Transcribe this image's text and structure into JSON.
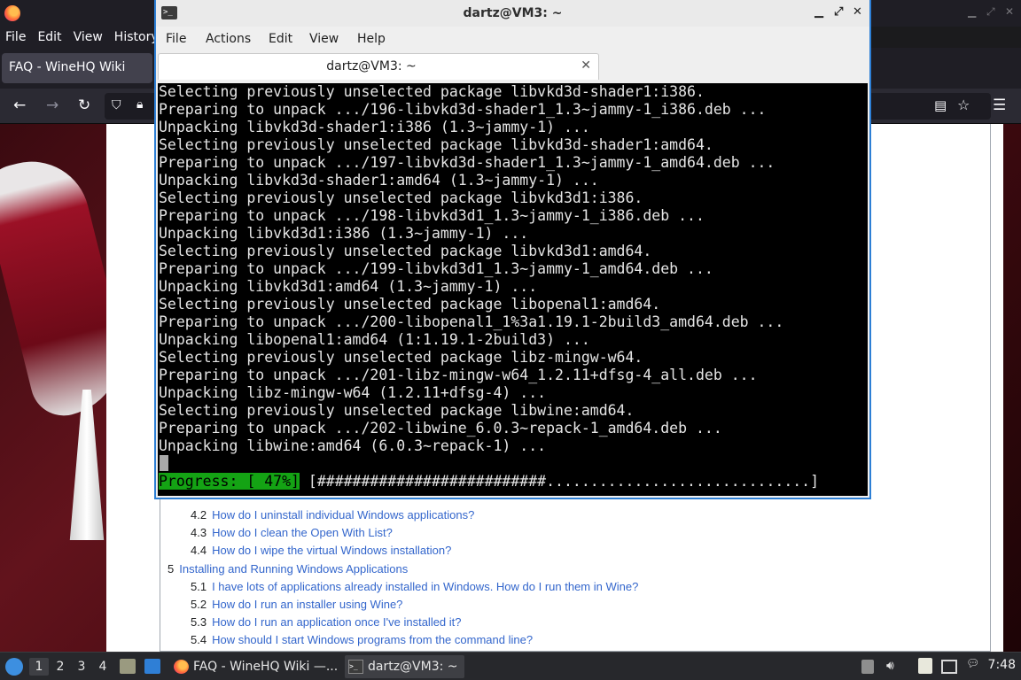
{
  "firefox": {
    "menu": [
      "File",
      "Edit",
      "View",
      "History"
    ],
    "tab_title": "FAQ - WineHQ Wiki",
    "toc": [
      {
        "num": "4.2",
        "text": "How do I uninstall individual Windows applications?",
        "level": 2
      },
      {
        "num": "4.3",
        "text": "How do I clean the Open With List?",
        "level": 2
      },
      {
        "num": "4.4",
        "text": "How do I wipe the virtual Windows installation?",
        "level": 2
      },
      {
        "num": "5",
        "text": "Installing and Running Windows Applications",
        "level": 1
      },
      {
        "num": "5.1",
        "text": "I have lots of applications already installed in Windows. How do I run them in Wine?",
        "level": 2
      },
      {
        "num": "5.2",
        "text": "How do I run an installer using Wine?",
        "level": 2
      },
      {
        "num": "5.3",
        "text": "How do I run an application once I've installed it?",
        "level": 2
      },
      {
        "num": "5.4",
        "text": "How should I start Windows programs from the command line?",
        "level": 2
      }
    ]
  },
  "terminal": {
    "title": "dartz@VM3: ~",
    "menu": [
      "File",
      "Actions",
      "Edit",
      "View",
      "Help"
    ],
    "tab_label": "dartz@VM3: ~",
    "lines": [
      "Selecting previously unselected package libvkd3d-shader1:i386.",
      "Preparing to unpack .../196-libvkd3d-shader1_1.3~jammy-1_i386.deb ...",
      "Unpacking libvkd3d-shader1:i386 (1.3~jammy-1) ...",
      "Selecting previously unselected package libvkd3d-shader1:amd64.",
      "Preparing to unpack .../197-libvkd3d-shader1_1.3~jammy-1_amd64.deb ...",
      "Unpacking libvkd3d-shader1:amd64 (1.3~jammy-1) ...",
      "Selecting previously unselected package libvkd3d1:i386.",
      "Preparing to unpack .../198-libvkd3d1_1.3~jammy-1_i386.deb ...",
      "Unpacking libvkd3d1:i386 (1.3~jammy-1) ...",
      "Selecting previously unselected package libvkd3d1:amd64.",
      "Preparing to unpack .../199-libvkd3d1_1.3~jammy-1_amd64.deb ...",
      "Unpacking libvkd3d1:amd64 (1.3~jammy-1) ...",
      "Selecting previously unselected package libopenal1:amd64.",
      "Preparing to unpack .../200-libopenal1_1%3a1.19.1-2build3_amd64.deb ...",
      "Unpacking libopenal1:amd64 (1:1.19.1-2build3) ...",
      "Selecting previously unselected package libz-mingw-w64.",
      "Preparing to unpack .../201-libz-mingw-w64_1.2.11+dfsg-4_all.deb ...",
      "Unpacking libz-mingw-w64 (1.2.11+dfsg-4) ...",
      "Selecting previously unselected package libwine:amd64.",
      "Preparing to unpack .../202-libwine_6.0.3~repack-1_amd64.deb ...",
      "Unpacking libwine:amd64 (6.0.3~repack-1) ..."
    ],
    "progress_label": "Progress: [ 47%]",
    "progress_bar": " [##########################..............................]",
    "progress_percent": 47
  },
  "taskbar": {
    "desktops": [
      "1",
      "2",
      "3",
      "4"
    ],
    "tasks": [
      {
        "label": "FAQ - WineHQ Wiki —...",
        "active": false
      },
      {
        "label": "dartz@VM3: ~",
        "active": true
      }
    ],
    "clock": "7:48"
  }
}
